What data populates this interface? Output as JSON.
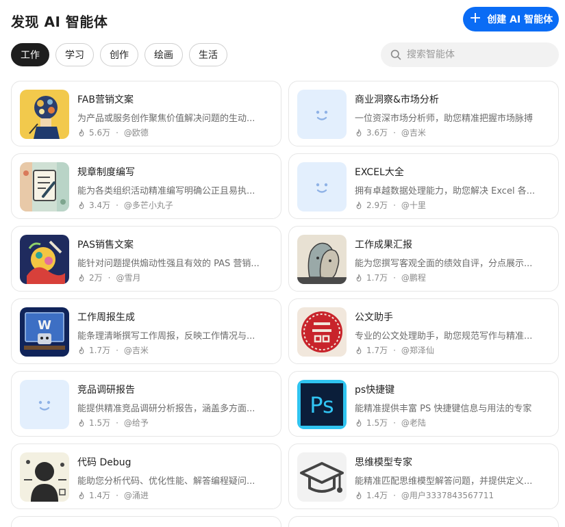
{
  "header": {
    "title": "发现 AI 智能体",
    "create_label": "创建 AI 智能体"
  },
  "tabs": [
    {
      "label": "工作",
      "active": true
    },
    {
      "label": "学习",
      "active": false
    },
    {
      "label": "创作",
      "active": false
    },
    {
      "label": "绘画",
      "active": false
    },
    {
      "label": "生活",
      "active": false
    }
  ],
  "search": {
    "placeholder": "搜索智能体"
  },
  "agents": [
    {
      "title": "FAB营销文案",
      "desc": "为产品或服务创作聚焦价值解决问题的生动...",
      "uses": "5.6万",
      "author": "@欧德",
      "thumb": "gears-head-icon"
    },
    {
      "title": "商业洞察&市场分析",
      "desc": "一位资深市场分析师，助您精准把握市场脉搏",
      "uses": "3.6万",
      "author": "@吉米",
      "thumb": "smiley-placeholder-icon"
    },
    {
      "title": "规章制度编写",
      "desc": "能为各类组织活动精准编写明确公正且易执...",
      "uses": "3.4万",
      "author": "@多芒小丸子",
      "thumb": "document-pen-icon"
    },
    {
      "title": "EXCEL大全",
      "desc": "拥有卓越数据处理能力，助您解决 Excel 各...",
      "uses": "2.9万",
      "author": "@十里",
      "thumb": "smiley-placeholder-icon"
    },
    {
      "title": "PAS销售文案",
      "desc": "能针对问题提供煽动性强且有效的 PAS 营销...",
      "uses": "2万",
      "author": "@雪月",
      "thumb": "colorful-art-icon"
    },
    {
      "title": "工作成果汇报",
      "desc": "能为您撰写客观全面的绩效自评，分点展示...",
      "uses": "1.7万",
      "author": "@鹏程",
      "thumb": "faces-illustration-icon"
    },
    {
      "title": "工作周报生成",
      "desc": "能条理清晰撰写工作周报，反映工作情况与...",
      "uses": "1.7万",
      "author": "@吉米",
      "thumb": "robot-desk-icon"
    },
    {
      "title": "公文助手",
      "desc": "专业的公文处理助手，助您规范写作与精准...",
      "uses": "1.7万",
      "author": "@郑泽仙",
      "thumb": "red-seal-icon"
    },
    {
      "title": "竞品调研报告",
      "desc": "能提供精准竞品调研分析报告，涵盖多方面...",
      "uses": "1.5万",
      "author": "@给予",
      "thumb": "smiley-placeholder-icon"
    },
    {
      "title": "ps快捷键",
      "desc": "能精准提供丰富 PS 快捷键信息与用法的专家",
      "uses": "1.5万",
      "author": "@老陆",
      "thumb": "photoshop-icon"
    },
    {
      "title": "代码 Debug",
      "desc": "能助您分析代码、优化性能、解答编程疑问...",
      "uses": "1.4万",
      "author": "@涌进",
      "thumb": "coder-silhouette-icon"
    },
    {
      "title": "思维模型专家",
      "desc": "能精准匹配思维模型解答问题，并提供定义...",
      "uses": "1.4万",
      "author": "@用户3337843567711",
      "thumb": "graduation-cap-icon"
    }
  ],
  "colors": {
    "accent": "#0a6cf5",
    "active_tab": "#1e1e1e",
    "placeholder_bg": "#e3effd",
    "seal_red": "#c8242b"
  }
}
